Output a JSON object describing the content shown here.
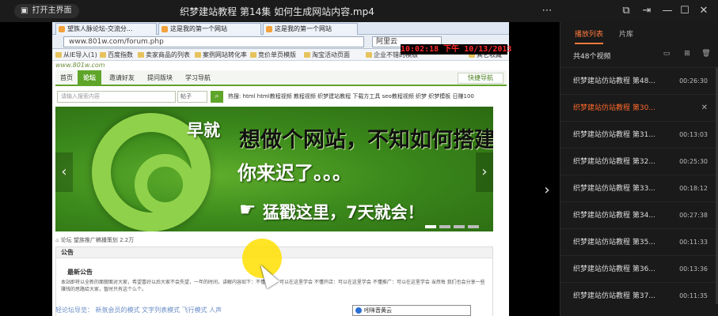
{
  "titlebar": {
    "home_label": "打开主界面",
    "title": "织梦建站教程 第14集 如何生成网站内容.mp4",
    "icons": [
      "list-icon",
      "screen-icon",
      "pin-icon",
      "minimize-icon",
      "maximize-icon",
      "close-icon"
    ]
  },
  "video": {
    "clock": "10:02:18 下午 10/13/2013",
    "browser": {
      "tabs": [
        "望族人脉论坛-交流分...",
        "这是我的第一个网站",
        "这是我的第一个网站"
      ],
      "address": "www.801w.com/forum.php",
      "search_engine": "阿里云",
      "favorites": [
        "从IE导入(1)",
        "百度指数",
        "卖家商品的列表",
        "案例网站转化率",
        "竞价单页模版",
        "淘宝活动页面",
        "企业不错的模版",
        "其它收藏"
      ]
    },
    "site": {
      "logo": "www.801w.com",
      "nav": [
        "首页",
        "论坛",
        "邀请好友",
        "提问版块",
        "学习导航"
      ],
      "quick_nav": "快捷导航",
      "search_placeholder": "请输入搜索内容",
      "search_type": "帖子",
      "hot_words": "热搜: html html教程视频 教程视频 织梦建站教程 下载方工具 seo教程视频 织梦 织梦模板 日赚100",
      "banner": {
        "line1a": "早就",
        "line1b": "想做个网站，不知如何搭建？",
        "line2": "你来迟了。。。",
        "line3": "猛戳这里，7天就会！"
      },
      "breadcrumb": "论坛    望族推广稿播策划   2.2万",
      "notice_head": "公告",
      "notice_title": "最新公告",
      "notice_body": "本站即将以全新的面貌面对大家，希望喜好以后大家不会失望，一年的时间，讲解内容如下：不懂建站：可以在这里学会 不懂开店：可以在这里学会 不懂推广：可以在这里学会 当然每 我们也会分享一些赚钱的思路给大家，暂时只有这个么个。",
      "guide": "轻论坛导览：     新氛会员的模式          文字列表模式          飞行模式          人声",
      "popup": "吲咪音黄云"
    }
  },
  "sidebar": {
    "tabs": [
      "播放列表",
      "片库"
    ],
    "count": "共48个视频",
    "items": [
      {
        "title": "织梦建站仿站教程 第48...",
        "duration": "00:26:30"
      },
      {
        "title": "织梦建站仿站教程 第30...",
        "duration": ""
      },
      {
        "title": "织梦建站仿站教程 第31...",
        "duration": "00:13:03"
      },
      {
        "title": "织梦建站仿站教程 第32...",
        "duration": "00:25:30"
      },
      {
        "title": "织梦建站仿站教程 第33...",
        "duration": "00:18:12"
      },
      {
        "title": "织梦建站仿站教程 第34...",
        "duration": "00:27:38"
      },
      {
        "title": "织梦建站仿站教程 第35...",
        "duration": "00:11:33"
      },
      {
        "title": "织梦建站仿站教程 第36...",
        "duration": "00:13:36"
      },
      {
        "title": "织梦建站仿站教程 第37...",
        "duration": "00:11:35"
      }
    ],
    "accent": "#ff6a2a"
  }
}
